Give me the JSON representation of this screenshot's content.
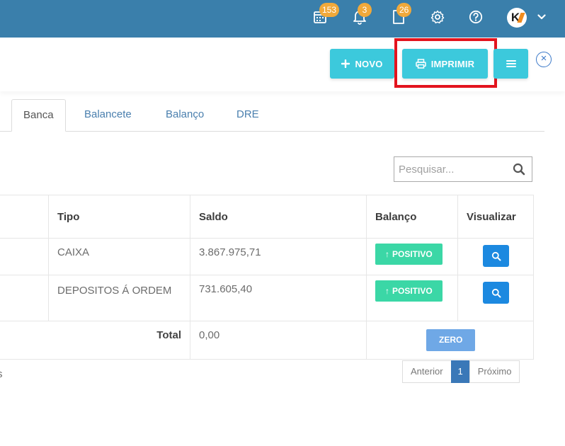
{
  "topbar": {
    "calendar_count": "153",
    "notifications_count": "3",
    "documents_count": "26"
  },
  "actions": {
    "new_label": "NOVO",
    "print_label": "IMPRIMIR"
  },
  "tabs": [
    {
      "label": "Banca"
    },
    {
      "label": "Balancete"
    },
    {
      "label": "Balanço"
    },
    {
      "label": "DRE"
    }
  ],
  "search": {
    "placeholder": "Pesquisar..."
  },
  "table": {
    "headers": [
      "Tipo",
      "Saldo",
      "Balanço",
      "Visualizar"
    ],
    "rows": [
      {
        "tipo": "CAIXA",
        "saldo": "3.867.975,71",
        "balanco": "POSITIVO"
      },
      {
        "tipo": "DEPOSITOS Á ORDEM",
        "saldo": "731.605,40",
        "balanco": "POSITIVO"
      }
    ],
    "total": {
      "label": "Total",
      "value": "0,00",
      "badge": "ZERO"
    }
  },
  "footer": {
    "truncated_text": "s"
  },
  "pagination": {
    "prev": "Anterior",
    "page": "1",
    "next": "Próximo"
  },
  "colors": {
    "topbar": "#3a7fab",
    "accent_cyan": "#3cc9dc",
    "positive": "#3bd7a6",
    "view_button": "#1c89e0",
    "highlight": "#e3141e"
  }
}
